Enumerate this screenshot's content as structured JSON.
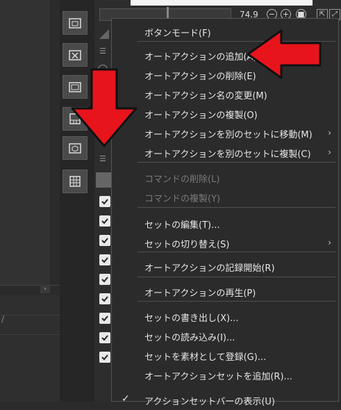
{
  "header": {
    "zoom_value": "74.9"
  },
  "context_menu": {
    "items": [
      {
        "label": "ボタンモード(F)",
        "enabled": true,
        "submenu": false,
        "checked": false
      },
      {
        "label": "オートアクションの追加(A)",
        "enabled": true,
        "submenu": false,
        "checked": false
      },
      {
        "label": "オートアクションの削除(E)",
        "enabled": true,
        "submenu": false,
        "checked": false
      },
      {
        "label": "オートアクション名の変更(M)",
        "enabled": true,
        "submenu": false,
        "checked": false
      },
      {
        "label": "オートアクションの複製(O)",
        "enabled": true,
        "submenu": false,
        "checked": false
      },
      {
        "label": "オートアクションを別のセットに移動(M)",
        "enabled": true,
        "submenu": true,
        "checked": false
      },
      {
        "label": "オートアクションを別のセットに複製(C)",
        "enabled": true,
        "submenu": true,
        "checked": false
      },
      {
        "label": "コマンドの削除(L)",
        "enabled": false,
        "submenu": false,
        "checked": false
      },
      {
        "label": "コマンドの複製(Y)",
        "enabled": false,
        "submenu": false,
        "checked": false
      },
      {
        "label": "セットの編集(T)...",
        "enabled": true,
        "submenu": false,
        "checked": false
      },
      {
        "label": "セットの切り替え(S)",
        "enabled": true,
        "submenu": true,
        "checked": false
      },
      {
        "label": "オートアクションの記録開始(R)",
        "enabled": true,
        "submenu": false,
        "checked": false
      },
      {
        "label": "オートアクションの再生(P)",
        "enabled": true,
        "submenu": false,
        "checked": false
      },
      {
        "label": "セットの書き出し(X)...",
        "enabled": true,
        "submenu": false,
        "checked": false
      },
      {
        "label": "セットの読み込み(I)...",
        "enabled": true,
        "submenu": false,
        "checked": false
      },
      {
        "label": "セットを素材として登録(G)...",
        "enabled": true,
        "submenu": false,
        "checked": false
      },
      {
        "label": "オートアクションセットを追加(R)...",
        "enabled": true,
        "submenu": false,
        "checked": false
      },
      {
        "label": "アクションセットバーの表示(U)",
        "enabled": true,
        "submenu": false,
        "checked": true
      }
    ],
    "submenu_arrow": "›",
    "check_glyph": "✓"
  },
  "tool_buttons": [
    {
      "icon": "folder-layout-icon"
    },
    {
      "icon": "folder-tools-icon"
    },
    {
      "icon": "folder-icon"
    },
    {
      "icon": "grid-partial-icon"
    },
    {
      "icon": "folder-cube-icon"
    },
    {
      "icon": "grid-icon"
    }
  ],
  "annotations": {
    "arrow_color": "#e8141c"
  },
  "list": {
    "checked_rows": 9
  }
}
